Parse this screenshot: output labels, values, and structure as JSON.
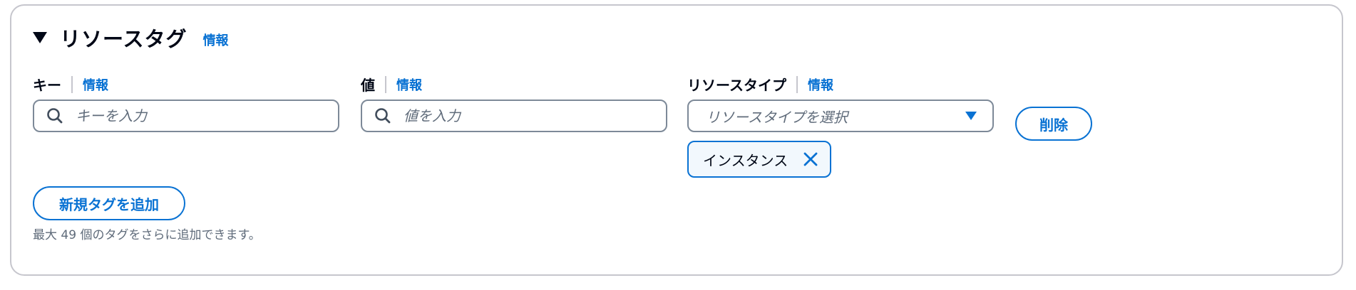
{
  "section": {
    "title": "リソースタグ",
    "info": "情報"
  },
  "fields": {
    "key": {
      "label": "キー",
      "info": "情報",
      "placeholder": "キーを入力"
    },
    "value": {
      "label": "値",
      "info": "情報",
      "placeholder": "値を入力"
    },
    "resource_type": {
      "label": "リソースタイプ",
      "info": "情報",
      "placeholder": "リソースタイプを選択"
    }
  },
  "remove_button": "削除",
  "selected_token": "インスタンス",
  "add_tag_button": "新規タグを追加",
  "hint": "最大 49 個のタグをさらに追加できます。",
  "colors": {
    "accent": "#0972d3",
    "border": "#7d8998",
    "token_bg": "#f2f8fd",
    "text_secondary": "#5f6b7a"
  }
}
